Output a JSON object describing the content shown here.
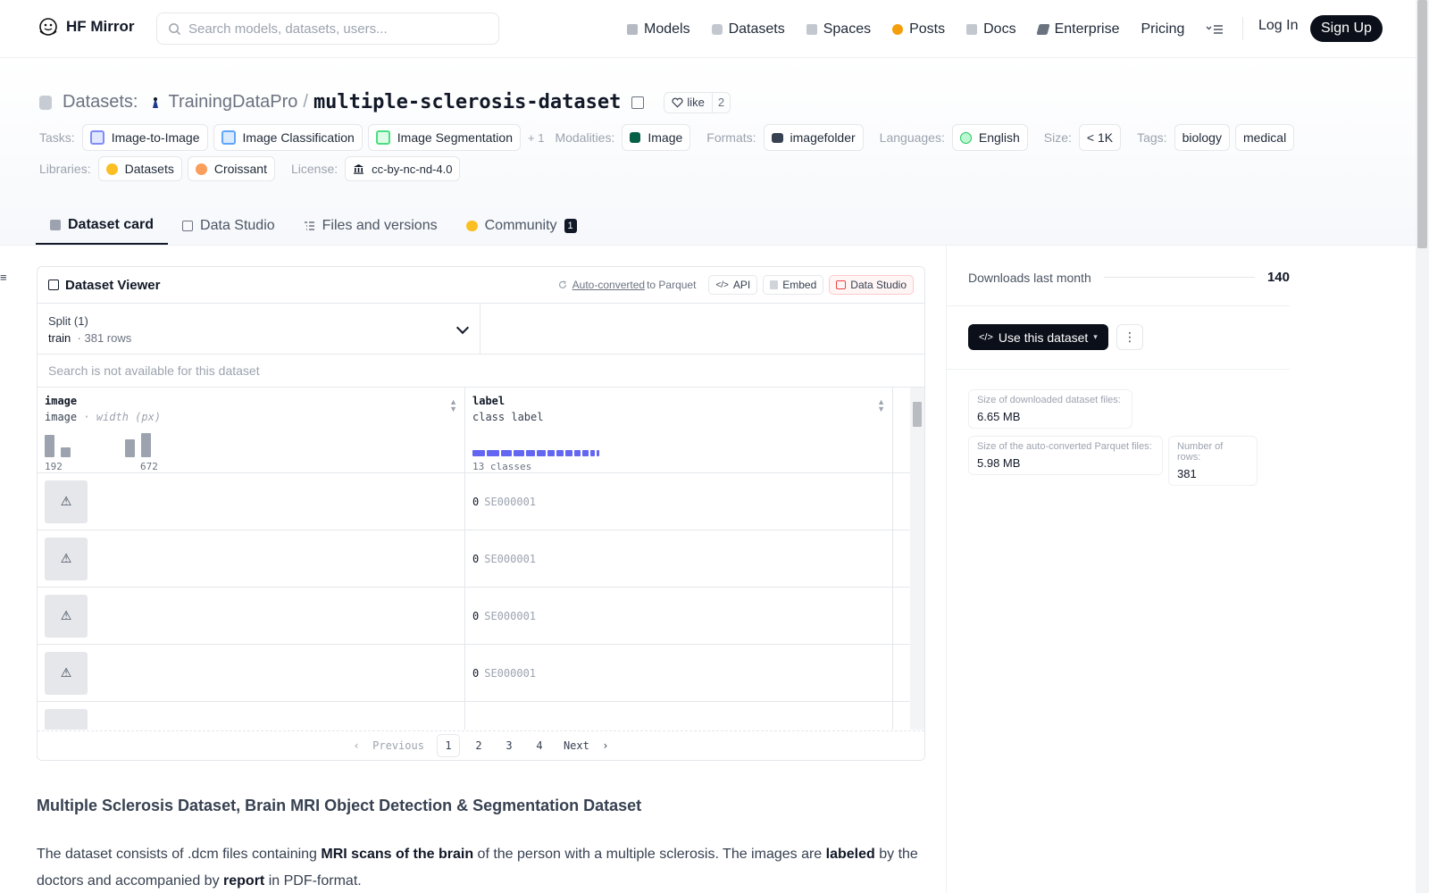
{
  "nav": {
    "brand": "HF Mirror",
    "search_placeholder": "Search models, datasets, users...",
    "links": [
      {
        "label": "Models",
        "icon": "cube-icon",
        "color": "#a1a7b3"
      },
      {
        "label": "Datasets",
        "icon": "database-icon",
        "color": "#a1a7b3"
      },
      {
        "label": "Spaces",
        "icon": "grid-icon",
        "color": "#a1a7b3"
      },
      {
        "label": "Posts",
        "icon": "speech-icon",
        "color": "#f59e0b"
      },
      {
        "label": "Docs",
        "icon": "book-icon",
        "color": "#a1a7b3"
      },
      {
        "label": "Enterprise",
        "icon": "enterprise-icon",
        "color": "#6b7280"
      },
      {
        "label": "Pricing",
        "icon": "",
        "color": ""
      }
    ],
    "login": "Log In",
    "signup": "Sign Up"
  },
  "header": {
    "section": "Datasets:",
    "org": "TrainingDataPro",
    "repo": "multiple-sclerosis-dataset",
    "like_label": "like",
    "like_count": "2"
  },
  "tags": {
    "tasks_label": "Tasks:",
    "tasks": [
      "Image-to-Image",
      "Image Classification",
      "Image Segmentation"
    ],
    "tasks_more": "+ 1",
    "modalities_label": "Modalities:",
    "modalities": [
      "Image"
    ],
    "formats_label": "Formats:",
    "formats": [
      "imagefolder"
    ],
    "languages_label": "Languages:",
    "languages": [
      "English"
    ],
    "size_label": "Size:",
    "size": "< 1K",
    "tags_label": "Tags:",
    "tags": [
      "biology",
      "medical"
    ],
    "libraries_label": "Libraries:",
    "libraries": [
      "Datasets",
      "Croissant"
    ],
    "license_label": "License:",
    "license": "cc-by-nc-nd-4.0"
  },
  "tabs": [
    {
      "label": "Dataset card",
      "active": true
    },
    {
      "label": "Data Studio",
      "active": false
    },
    {
      "label": "Files and versions",
      "active": false
    },
    {
      "label": "Community",
      "active": false,
      "badge": "1"
    }
  ],
  "viewer": {
    "title": "Dataset Viewer",
    "auto_converted": "Auto-converted",
    "to_parquet": "to Parquet",
    "api": "API",
    "embed": "Embed",
    "data_studio": "Data Studio",
    "split_label": "Split (1)",
    "split_name": "train",
    "split_rows": "381 rows",
    "search_note": "Search is not available for this dataset",
    "columns": [
      {
        "name": "image",
        "type": "image",
        "subtype": "width (px)",
        "min": "192",
        "max": "672"
      },
      {
        "name": "label",
        "type": "class label",
        "classes": "13 classes"
      }
    ],
    "histogram": [
      0.9,
      0.4,
      0,
      0,
      0,
      0.7,
      0.95
    ],
    "rows": [
      {
        "label_id": "0",
        "label_name": "SE000001"
      },
      {
        "label_id": "0",
        "label_name": "SE000001"
      },
      {
        "label_id": "0",
        "label_name": "SE000001"
      },
      {
        "label_id": "0",
        "label_name": "SE000001"
      }
    ],
    "pager": {
      "prev": "Previous",
      "pages": [
        "1",
        "2",
        "3",
        "4"
      ],
      "current": "1",
      "next": "Next"
    }
  },
  "side": {
    "downloads_label": "Downloads last month",
    "downloads": "140",
    "use_dataset": "Use this dataset",
    "stats": {
      "download_size_label": "Size of downloaded dataset files:",
      "download_size": "6.65 MB",
      "parquet_size_label": "Size of the auto-converted Parquet files:",
      "parquet_size": "5.98 MB",
      "rows_label": "Number of rows:",
      "rows": "381"
    }
  },
  "readme": {
    "heading": "Multiple Sclerosis Dataset, Brain MRI Object Detection & Segmentation Dataset",
    "p1_a": "The dataset consists of .dcm files containing ",
    "p1_b": "MRI scans of the brain",
    "p1_c": " of the person with a multiple sclerosis. The images are ",
    "p1_d": "labeled",
    "p1_e": " by the doctors and accompanied by ",
    "p1_f": "report",
    "p1_g": " in PDF-format."
  }
}
